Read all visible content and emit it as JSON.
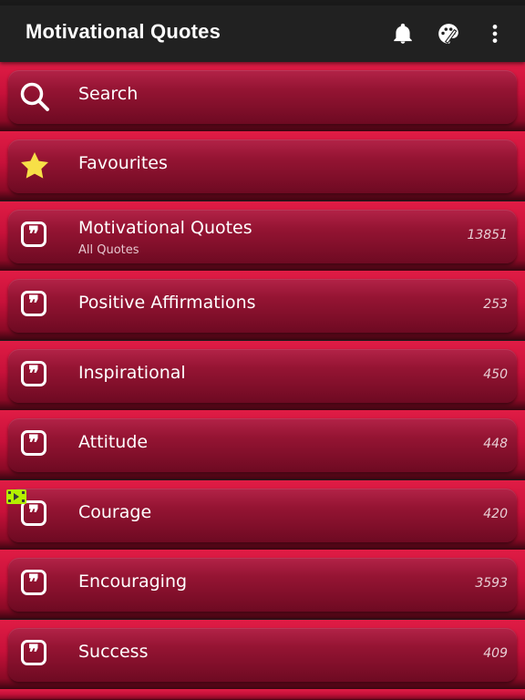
{
  "app": {
    "title": "Motivational Quotes",
    "accent_color": "#c8113a",
    "toolbar_icons": [
      "bell-icon",
      "palette-icon",
      "more-vert-icon"
    ]
  },
  "menu": {
    "search_label": "Search",
    "favourites_label": "Favourites"
  },
  "categories": [
    {
      "title": "Motivational Quotes",
      "subtitle": "All Quotes",
      "count": "13851"
    },
    {
      "title": "Positive Affirmations",
      "count": "253"
    },
    {
      "title": "Inspirational",
      "count": "450"
    },
    {
      "title": "Attitude",
      "count": "448"
    },
    {
      "title": "Courage",
      "count": "420"
    },
    {
      "title": "Encouraging",
      "count": "3593"
    },
    {
      "title": "Success",
      "count": "409"
    }
  ],
  "quote_glyph": "❞"
}
